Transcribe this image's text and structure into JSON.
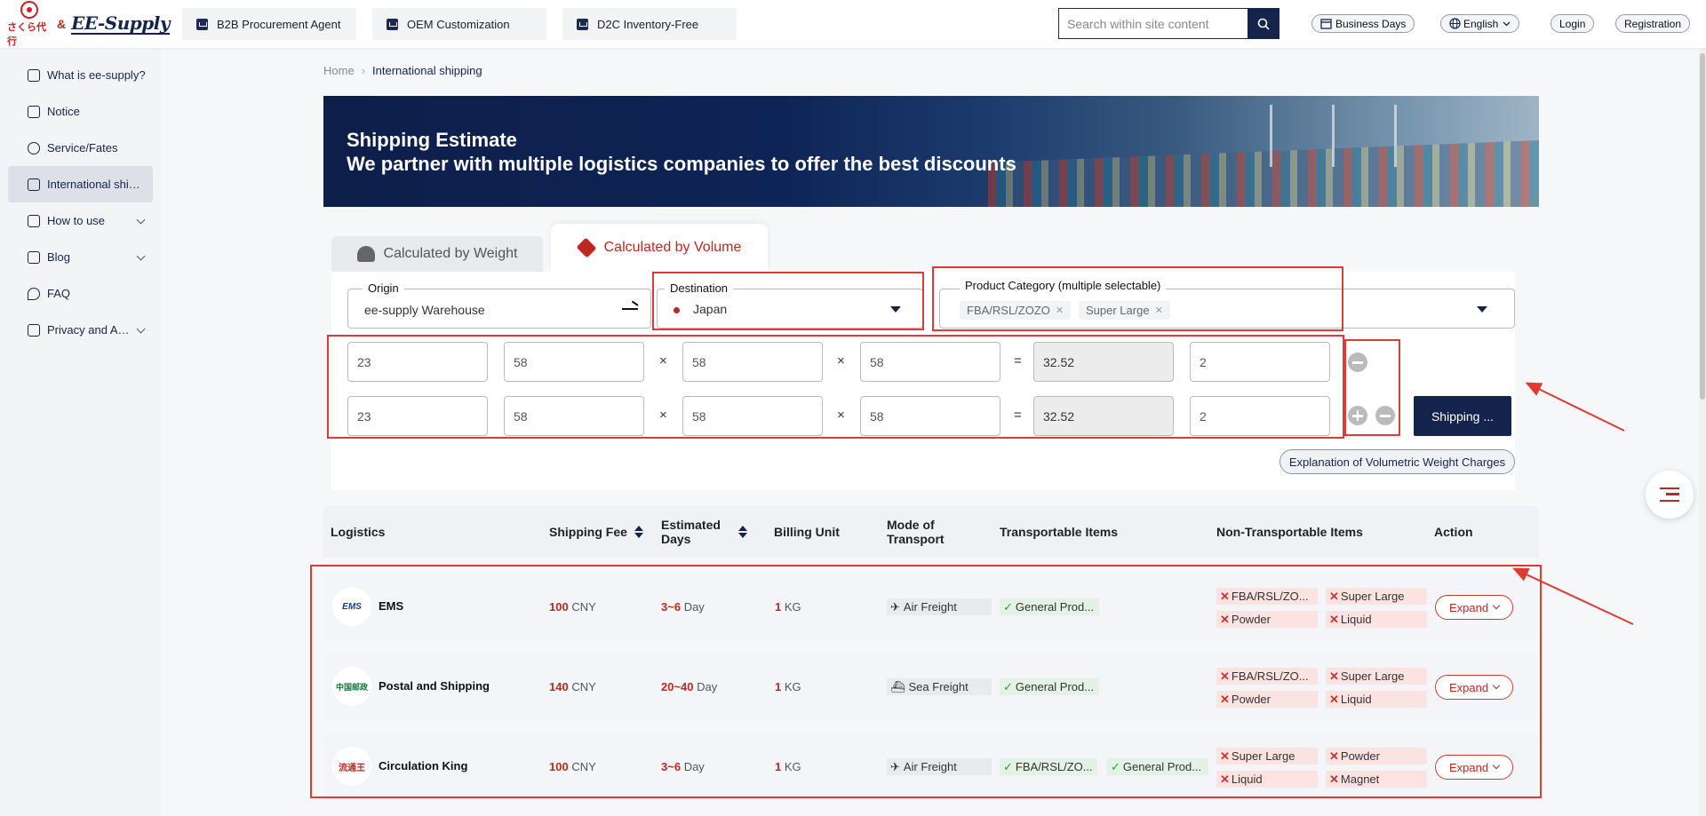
{
  "header": {
    "logo_sakura": "さくら代行",
    "logo_amp": "&",
    "logo_ee": "EE-Supply",
    "nav": [
      {
        "label": "B2B Procurement Agent",
        "icon": "b2b-icon"
      },
      {
        "label": "OEM Customization",
        "icon": "oem-icon"
      },
      {
        "label": "D2C Inventory-Free",
        "icon": "d2c-icon"
      }
    ],
    "search_placeholder": "Search within site content",
    "business_days": "Business Days",
    "language": "English",
    "login": "Login",
    "registration": "Registration"
  },
  "sidebar": {
    "items": [
      {
        "label": "What is ee-supply?"
      },
      {
        "label": "Notice"
      },
      {
        "label": "Service/Fates"
      },
      {
        "label": "International shipping"
      },
      {
        "label": "How to use"
      },
      {
        "label": "Blog"
      },
      {
        "label": "FAQ"
      },
      {
        "label": "Privacy and Agreement"
      }
    ]
  },
  "breadcrumb": {
    "home": "Home",
    "sep": "›",
    "current": "International shipping"
  },
  "banner": {
    "title": "Shipping Estimate",
    "subtitle": "We partner with multiple logistics companies to offer the best discounts"
  },
  "tabs": {
    "weight": "Calculated by Weight",
    "volume": "Calculated by Volume"
  },
  "form": {
    "origin_label": "Origin",
    "origin_value": "ee-supply Warehouse",
    "destination_label": "Destination",
    "destination_value": "Japan",
    "category_label": "Product Category (multiple selectable)",
    "category_tags": [
      "FBA/RSL/ZOZO",
      "Super Large"
    ],
    "rows": [
      {
        "weight": "23",
        "length": "58",
        "width": "58",
        "height": "58",
        "volumetric": "32.52",
        "qty": "2"
      },
      {
        "weight": "23",
        "length": "58",
        "width": "58",
        "height": "58",
        "volumetric": "32.52",
        "qty": "2"
      }
    ],
    "times": "×",
    "equals": "=",
    "ship_button": "Shipping ...",
    "explain_button": "Explanation of Volumetric Weight Charges"
  },
  "table": {
    "headers": {
      "logistics": "Logistics",
      "fee": "Shipping Fee",
      "days_1": "Estimated",
      "days_2": "Days",
      "unit": "Billing Unit",
      "mode_1": "Mode of",
      "mode_2": "Transport",
      "ok": "Transportable Items",
      "no": "Non-Transportable Items",
      "action": "Action"
    },
    "rows": [
      {
        "logo": "EMS",
        "name": "EMS",
        "fee": "100",
        "fee_unit": "CNY",
        "days": "3~6",
        "days_unit": "Day",
        "unit": "1",
        "unit_label": "KG",
        "mode": "Air Freight",
        "ok": [
          "General Prod..."
        ],
        "no": [
          "FBA/RSL/ZO...",
          "Super Large",
          "Powder",
          "Liquid"
        ],
        "action": "Expand"
      },
      {
        "logo": "中国邮政",
        "name": "Postal and Shipping",
        "fee": "140",
        "fee_unit": "CNY",
        "days": "20~40",
        "days_unit": "Day",
        "unit": "1",
        "unit_label": "KG",
        "mode": "Sea Freight",
        "ok": [
          "General Prod..."
        ],
        "no": [
          "FBA/RSL/ZO...",
          "Super Large",
          "Powder",
          "Liquid"
        ],
        "action": "Expand"
      },
      {
        "logo": "流通王",
        "name": "Circulation King",
        "fee": "100",
        "fee_unit": "CNY",
        "days": "3~6",
        "days_unit": "Day",
        "unit": "1",
        "unit_label": "KG",
        "mode": "Air Freight",
        "ok": [
          "FBA/RSL/ZO...",
          "General Prod..."
        ],
        "no": [
          "Super Large",
          "Powder",
          "Liquid",
          "Magnet"
        ],
        "action": "Expand"
      }
    ]
  },
  "colors": {
    "brand": "#14244d",
    "accent": "#c0281f",
    "annotation": "#e03a32"
  }
}
